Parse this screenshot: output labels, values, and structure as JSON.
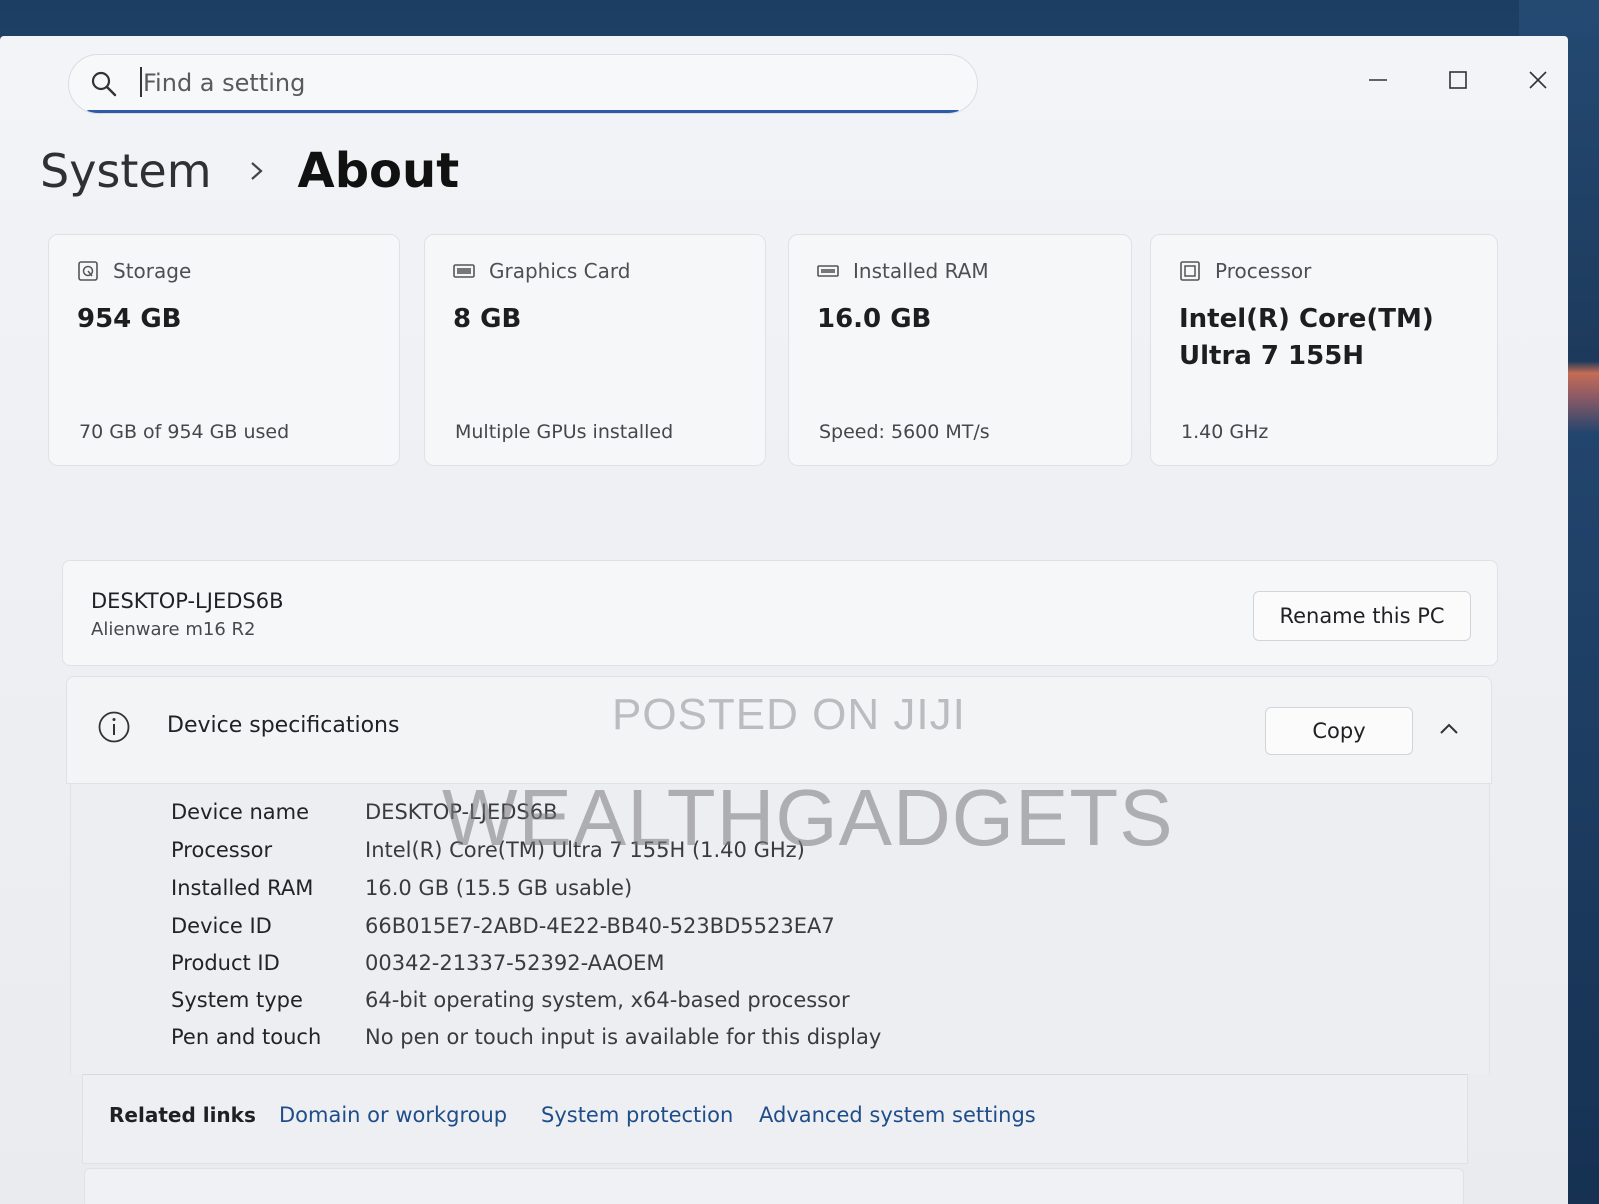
{
  "search": {
    "placeholder": "Find a setting"
  },
  "breadcrumb": {
    "parent": "System",
    "current": "About"
  },
  "cards": [
    {
      "icon": "storage-icon",
      "label": "Storage",
      "value": "954 GB",
      "sub": "70 GB of 954 GB used"
    },
    {
      "icon": "graphics-card-icon",
      "label": "Graphics Card",
      "value": "8 GB",
      "sub": "Multiple GPUs installed"
    },
    {
      "icon": "ram-icon",
      "label": "Installed RAM",
      "value": "16.0 GB",
      "sub": "Speed: 5600 MT/s"
    },
    {
      "icon": "processor-icon",
      "label": "Processor",
      "value_line1": "Intel(R) Core(TM)",
      "value_line2": "Ultra 7 155H",
      "sub": "1.40 GHz"
    }
  ],
  "pc": {
    "name": "DESKTOP-LJEDS6B",
    "model": "Alienware m16 R2",
    "rename_label": "Rename this PC"
  },
  "device_specs": {
    "title": "Device specifications",
    "copy_label": "Copy",
    "rows": [
      {
        "key": "Device name",
        "value": "DESKTOP-LJEDS6B"
      },
      {
        "key": "Processor",
        "value": "Intel(R) Core(TM) Ultra 7 155H (1.40 GHz)"
      },
      {
        "key": "Installed RAM",
        "value": "16.0 GB (15.5 GB usable)"
      },
      {
        "key": "Device ID",
        "value": "66B015E7-2ABD-4E22-BB40-523BD5523EA7"
      },
      {
        "key": "Product ID",
        "value": "00342-21337-52392-AAOEM"
      },
      {
        "key": "System type",
        "value": "64-bit operating system, x64-based processor"
      },
      {
        "key": "Pen and touch",
        "value": "No pen or touch input is available for this display"
      }
    ]
  },
  "related_links": {
    "label": "Related links",
    "links": [
      "Domain or workgroup",
      "System protection",
      "Advanced system settings"
    ]
  },
  "watermark": {
    "line1": "POSTED ON JIJI",
    "line2": "WEALTHGADGETS"
  },
  "colors": {
    "accent": "#2d5aa8",
    "link": "#1f4d8a"
  }
}
